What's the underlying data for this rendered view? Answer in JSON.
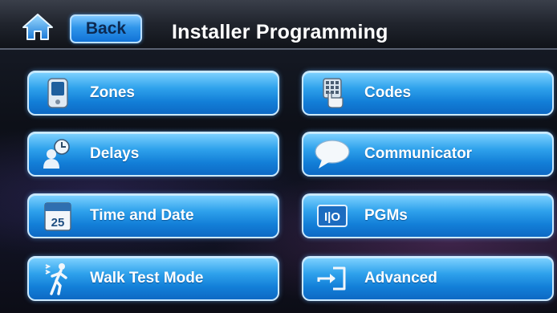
{
  "header": {
    "title": "Installer Programming",
    "back_label": "Back",
    "home_icon": "home-icon"
  },
  "menu": {
    "zones": {
      "label": "Zones",
      "icon": "keypad-device-icon"
    },
    "codes": {
      "label": "Codes",
      "icon": "hand-keypad-icon"
    },
    "delays": {
      "label": "Delays",
      "icon": "person-clock-icon"
    },
    "communicator": {
      "label": "Communicator",
      "icon": "speech-bubble-icon"
    },
    "time_date": {
      "label": "Time and Date",
      "icon": "calendar-icon",
      "calendar_day": "25"
    },
    "pgms": {
      "label": "PGMs",
      "icon": "io-icon",
      "icon_text": "I|O"
    },
    "walk_test": {
      "label": "Walk Test Mode",
      "icon": "walking-person-icon"
    },
    "advanced": {
      "label": "Advanced",
      "icon": "enter-arrow-icon"
    }
  },
  "colors": {
    "button_top": "#7fd2ff",
    "button_bottom": "#0d69c4",
    "button_border": "#cbe9ff",
    "back_text": "#0d2a52"
  }
}
